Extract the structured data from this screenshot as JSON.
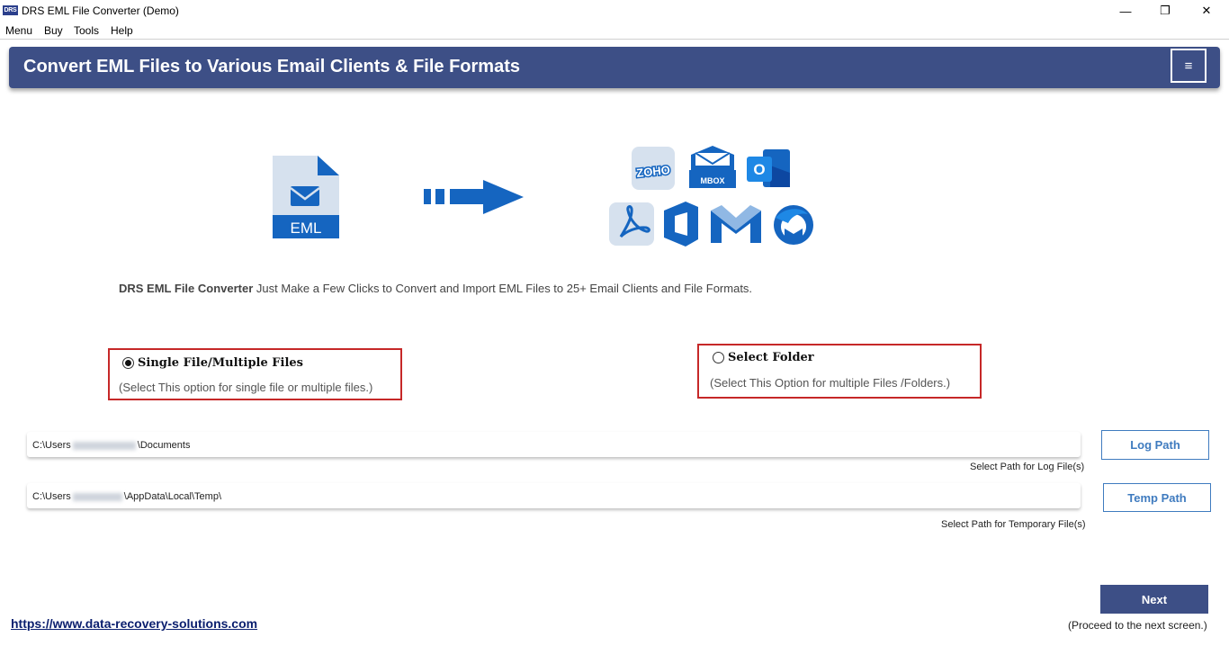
{
  "window": {
    "title": "DRS EML File Converter (Demo)",
    "app_icon_text": "DRS",
    "minimize_glyph": "—",
    "maximize_glyph": "❐",
    "close_glyph": "✕"
  },
  "menu": {
    "items": [
      {
        "label": "Menu"
      },
      {
        "label": "Buy"
      },
      {
        "label": "Tools"
      },
      {
        "label": "Help"
      }
    ]
  },
  "header": {
    "title": "Convert EML Files to Various Email Clients & File Formats",
    "menu_glyph": "≡"
  },
  "illustration": {
    "source_label": "EML",
    "targets": [
      "zoho-icon",
      "mbox-icon",
      "outlook-icon",
      "pdf-icon",
      "office365-icon",
      "gmail-icon",
      "thunderbird-icon"
    ],
    "zoho_text": "ZOHO",
    "mbox_text": "MBOX",
    "outlook_letter": "O"
  },
  "description": {
    "product": "DRS EML File Converter",
    "text": " Just Make a Few Clicks to Convert and Import EML Files to 25+ Email Clients and File Formats."
  },
  "options": {
    "single": {
      "label": "Single File/Multiple Files",
      "hint": "(Select This option for single file or multiple files.)",
      "selected": true
    },
    "folder": {
      "label": "Select Folder",
      "hint": "(Select This Option for multiple Files /Folders.)",
      "selected": false
    }
  },
  "paths": {
    "log": {
      "prefix": "C:\\Users",
      "suffix": "\\Documents",
      "caption": "Select Path for Log File(s)",
      "button": "Log Path"
    },
    "temp": {
      "prefix": "C:\\Users",
      "suffix": "\\AppData\\Local\\Temp\\",
      "caption": "Select Path for Temporary File(s)",
      "button": "Temp Path"
    }
  },
  "footer": {
    "link": "https://www.data-recovery-solutions.com",
    "next_button": "Next",
    "next_hint": "(Proceed to the next screen.)"
  },
  "colors": {
    "brand": "#3d4f86",
    "accent_blue": "#1565c0",
    "highlight_border": "#c62828",
    "link": "#0a1e6e"
  }
}
